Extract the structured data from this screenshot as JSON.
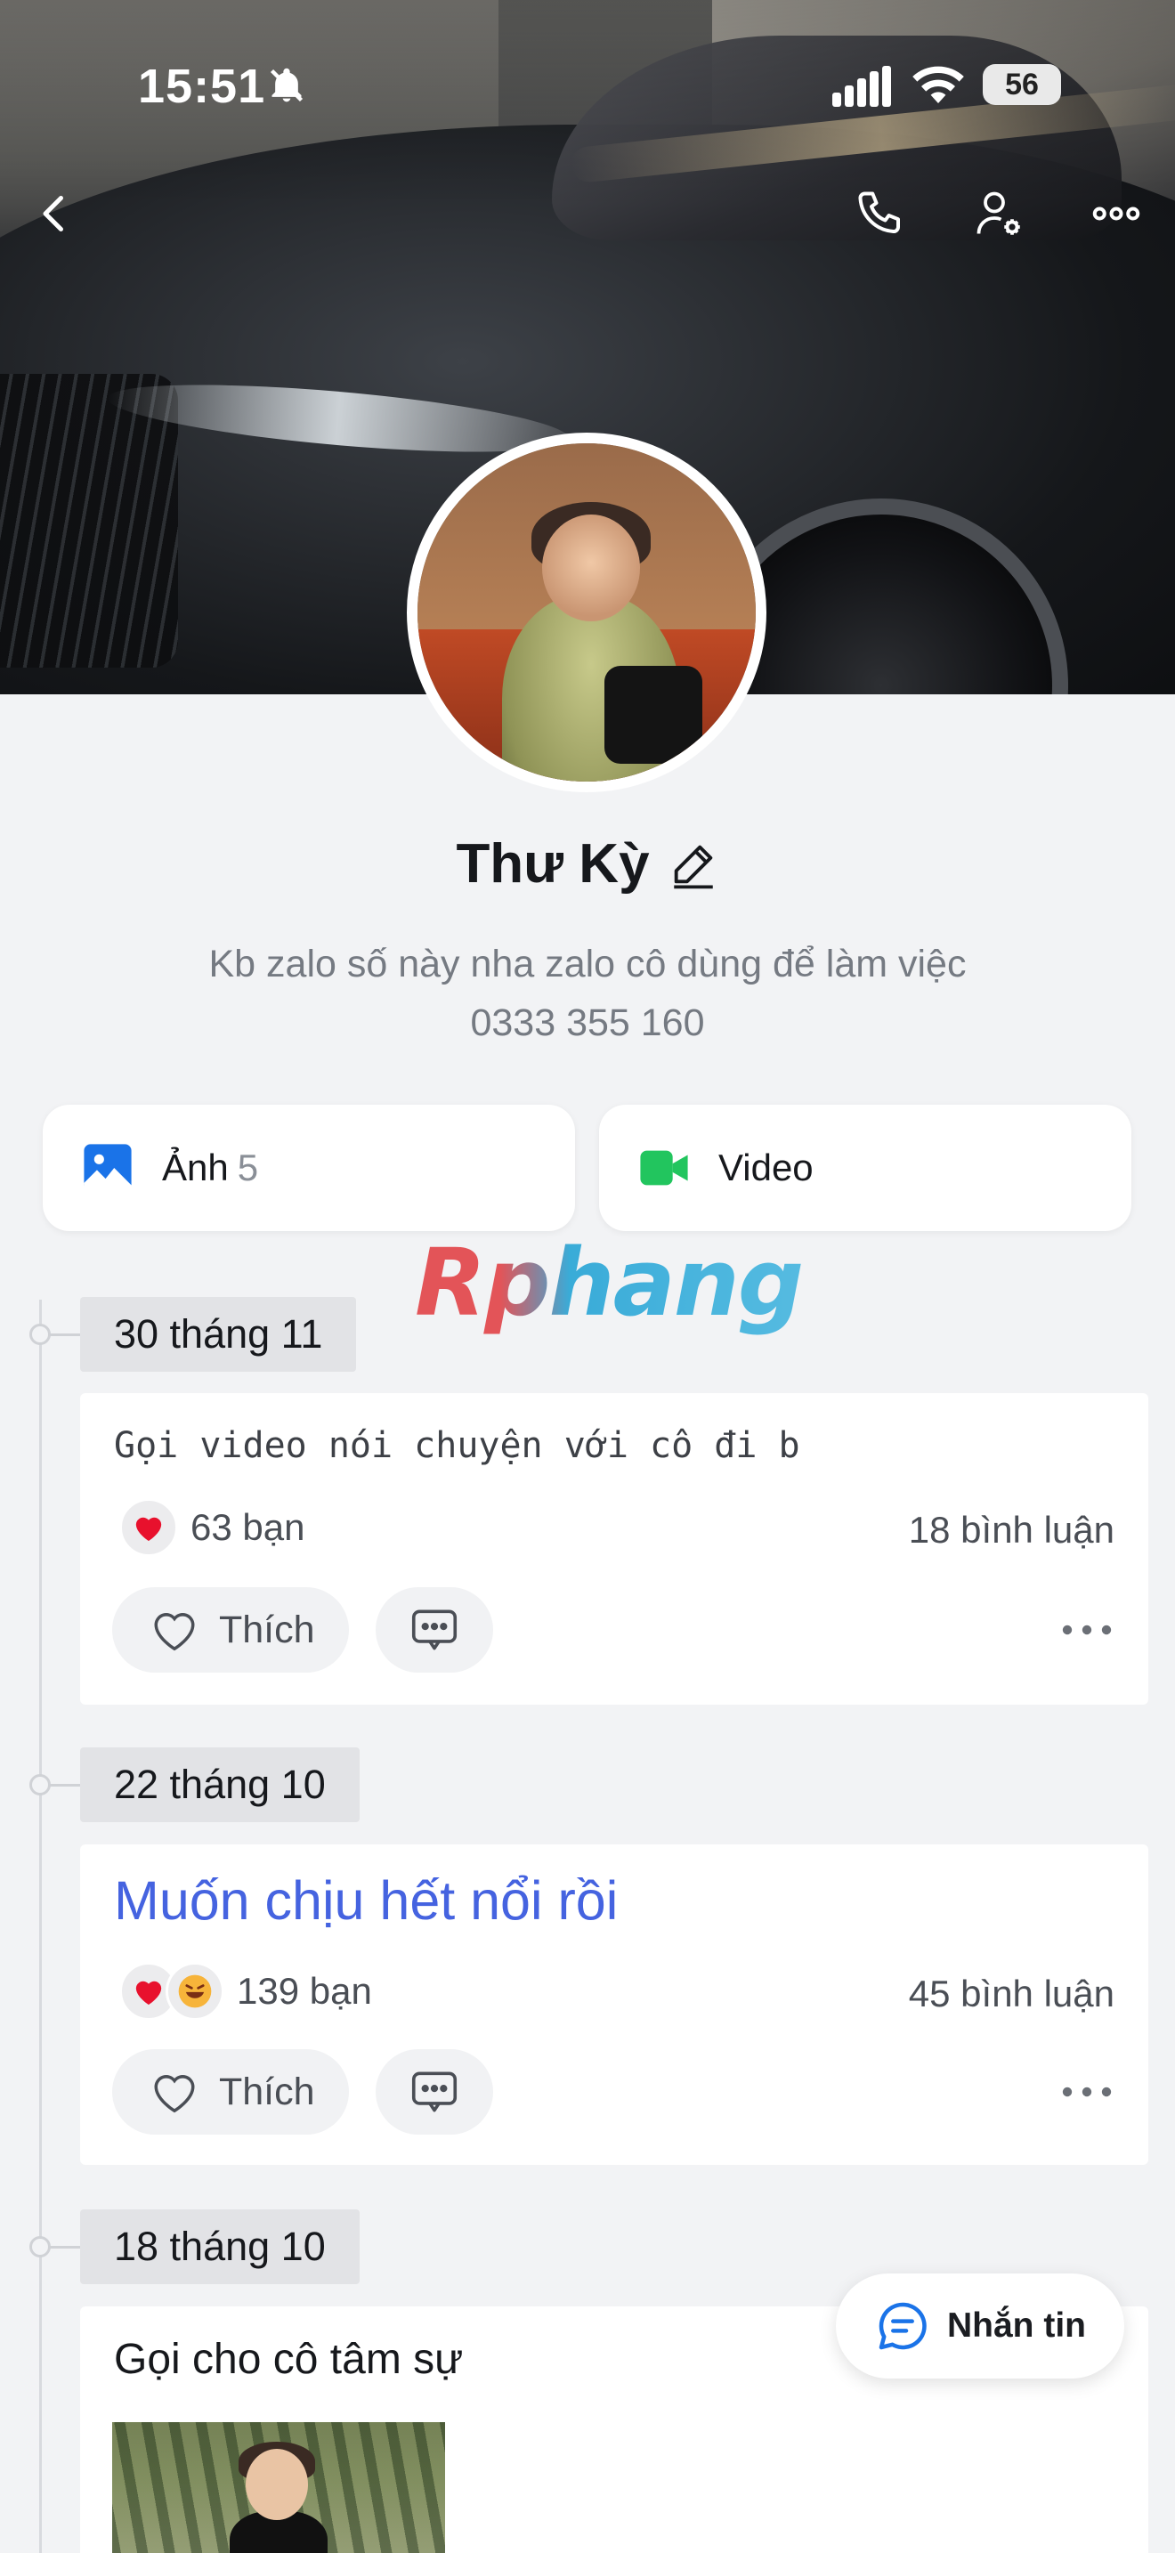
{
  "status_bar": {
    "time": "15:51",
    "battery": "56"
  },
  "profile": {
    "name": "Thư Kỳ",
    "bio_line1": "Kb zalo số này nha zalo cô dùng để làm việc",
    "bio_line2": "0333 355 160"
  },
  "media": {
    "photos_label": "Ảnh",
    "photos_count": "5",
    "video_label": "Video"
  },
  "watermark": "Rphang",
  "timeline": [
    {
      "date": "30 tháng 11",
      "text": "Gọi video nói chuyện với cô đi b",
      "reactions": [
        "heart"
      ],
      "reaction_count": "63 bạn",
      "comment_count": "18 bình luận",
      "like_label": "Thích"
    },
    {
      "date": "22 tháng 10",
      "text": "Muốn chịu hết nổi rồi",
      "reactions": [
        "heart",
        "laugh"
      ],
      "reaction_count": "139 bạn",
      "comment_count": "45 bình luận",
      "like_label": "Thích"
    },
    {
      "date": "18 tháng 10",
      "text": "Gọi cho cô tâm sự"
    }
  ],
  "fab": {
    "label": "Nhắn tin"
  },
  "colors": {
    "accent_blue": "#4563e0",
    "photo_icon_blue": "#1a73e8",
    "video_icon_green": "#22c55e",
    "heart_red": "#e8112d"
  },
  "icons": {
    "back": "chevron-left-icon",
    "call": "phone-icon",
    "profile_settings": "user-gear-icon",
    "more": "more-horizontal-icon"
  }
}
